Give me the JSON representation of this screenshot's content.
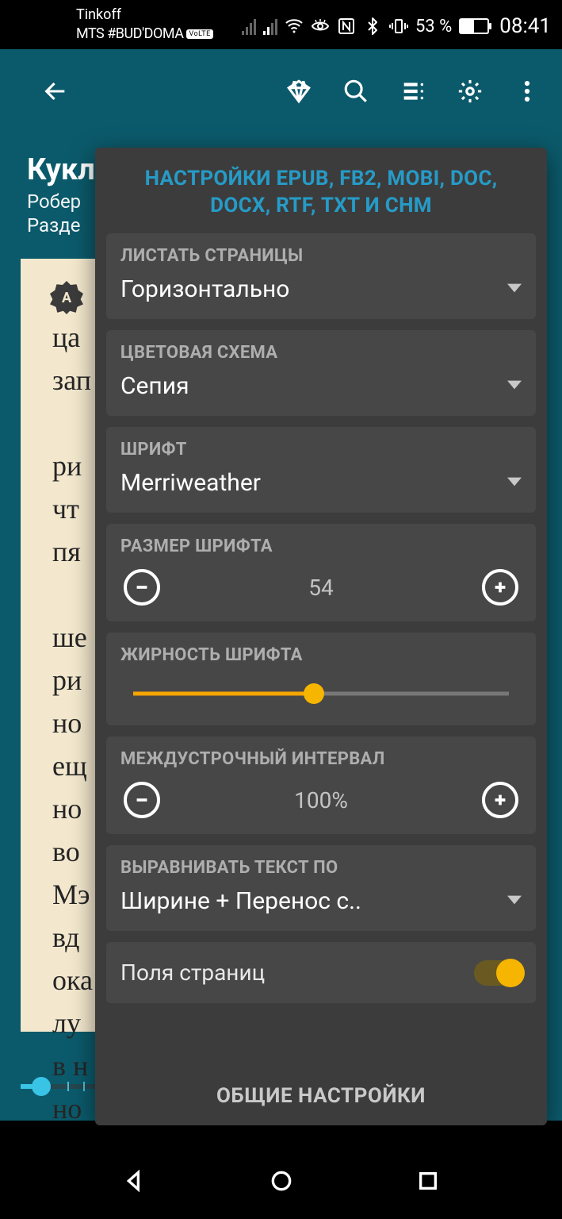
{
  "status": {
    "carrier1": "Tinkoff",
    "carrier2": "MTS #BUD'DOMA",
    "volte": "VoLTE",
    "battery_pct": "53 %",
    "time": "08:41"
  },
  "book": {
    "title": "Кукл",
    "author": "Робер",
    "section": "Разде"
  },
  "page_text": "ца\nзап\n\nри\nчт\nпя\n\nше\nри\nно\nещ\nно\nво\nМэ\nвд\nока\nлу\nв н\nно\nко",
  "panel": {
    "title": "НАСТРОЙКИ EPUB, FB2, MOBI, DOC, DOCX, RTF, TXT И CHM",
    "paging_label": "ЛИСТАТЬ СТРАНИЦЫ",
    "paging_value": "Горизонтально",
    "color_label": "ЦВЕТОВАЯ СХЕМА",
    "color_value": "Сепия",
    "font_label": "ШРИФТ",
    "font_value": "Merriweather",
    "fontsize_label": "РАЗМЕР ШРИФТА",
    "fontsize_value": "54",
    "weight_label": "ЖИРНОСТЬ ШРИФТА",
    "weight_percent": 48,
    "linespacing_label": "МЕЖДУСТРОЧНЫЙ ИНТЕРВАЛ",
    "linespacing_value": "100%",
    "align_label": "ВЫРАВНИВАТЬ ТЕКСТ ПО",
    "align_value": "Ширине + Перенос с..",
    "margins_label": "Поля страниц",
    "footer": "ОБЩИЕ НАСТРОЙКИ"
  },
  "badge_letter": "A"
}
